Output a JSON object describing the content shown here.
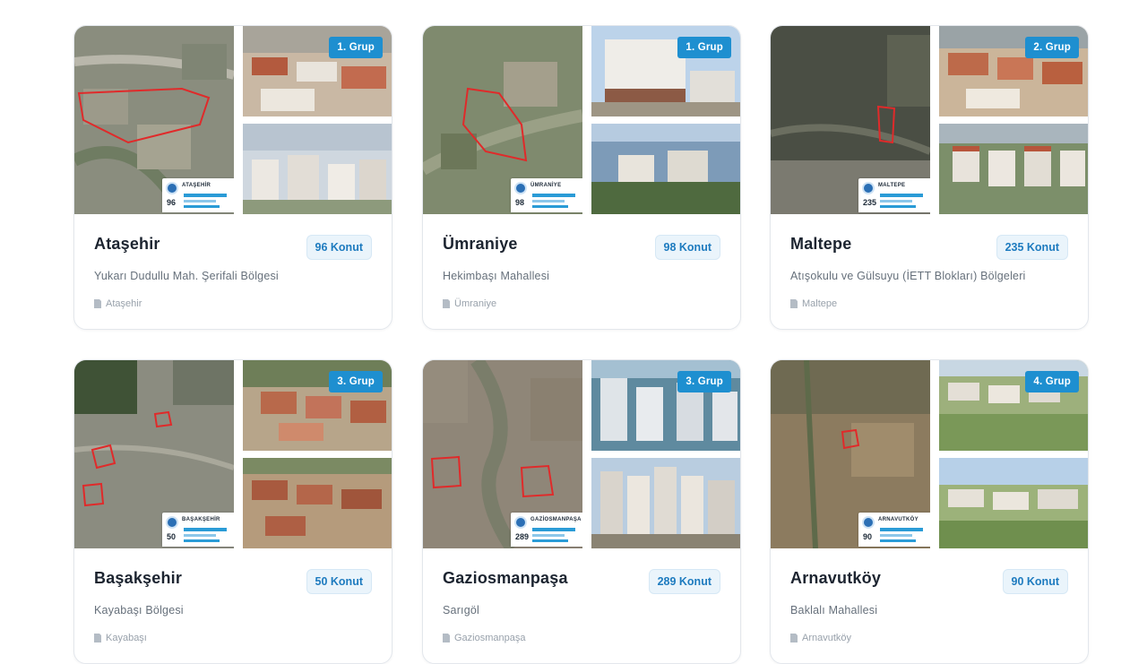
{
  "cards": [
    {
      "group": "1. Grup",
      "mini_title": "ATAŞEHİR",
      "mini_number": "96",
      "title": "Ataşehir",
      "badge": "96 Konut",
      "subtitle": "Yukarı Dudullu Mah. Şerifali Bölgesi",
      "location": "Ataşehir"
    },
    {
      "group": "1. Grup",
      "mini_title": "ÜMRANİYE",
      "mini_number": "98",
      "title": "Ümraniye",
      "badge": "98 Konut",
      "subtitle": "Hekimbaşı Mahallesi",
      "location": "Ümraniye"
    },
    {
      "group": "2. Grup",
      "mini_title": "MALTEPE",
      "mini_number": "235",
      "title": "Maltepe",
      "badge": "235 Konut",
      "subtitle": "Atışokulu ve Gülsuyu (İETT Blokları) Bölgeleri",
      "location": "Maltepe"
    },
    {
      "group": "3. Grup",
      "mini_title": "BAŞAKŞEHİR",
      "mini_number": "50",
      "title": "Başakşehir",
      "badge": "50 Konut",
      "subtitle": "Kayabaşı Bölgesi",
      "location": "Kayabaşı"
    },
    {
      "group": "3. Grup",
      "mini_title": "GAZİOSMANPAŞA",
      "mini_number": "289",
      "title": "Gaziosmanpaşa",
      "badge": "289 Konut",
      "subtitle": "Sarıgöl",
      "location": "Gaziosmanpaşa"
    },
    {
      "group": "4. Grup",
      "mini_title": "ARNAVUTKÖY",
      "mini_number": "90",
      "title": "Arnavutköy",
      "badge": "90 Konut",
      "subtitle": "Baklalı Mahallesi",
      "location": "Arnavutköy"
    }
  ],
  "colors": {
    "accent": "#1e8fd0",
    "badge_bg": "#eaf4fb",
    "badge_text": "#1e7bbf",
    "title": "#1c2430",
    "muted": "#66707b"
  },
  "icons": {
    "location": "document-pin-icon"
  }
}
